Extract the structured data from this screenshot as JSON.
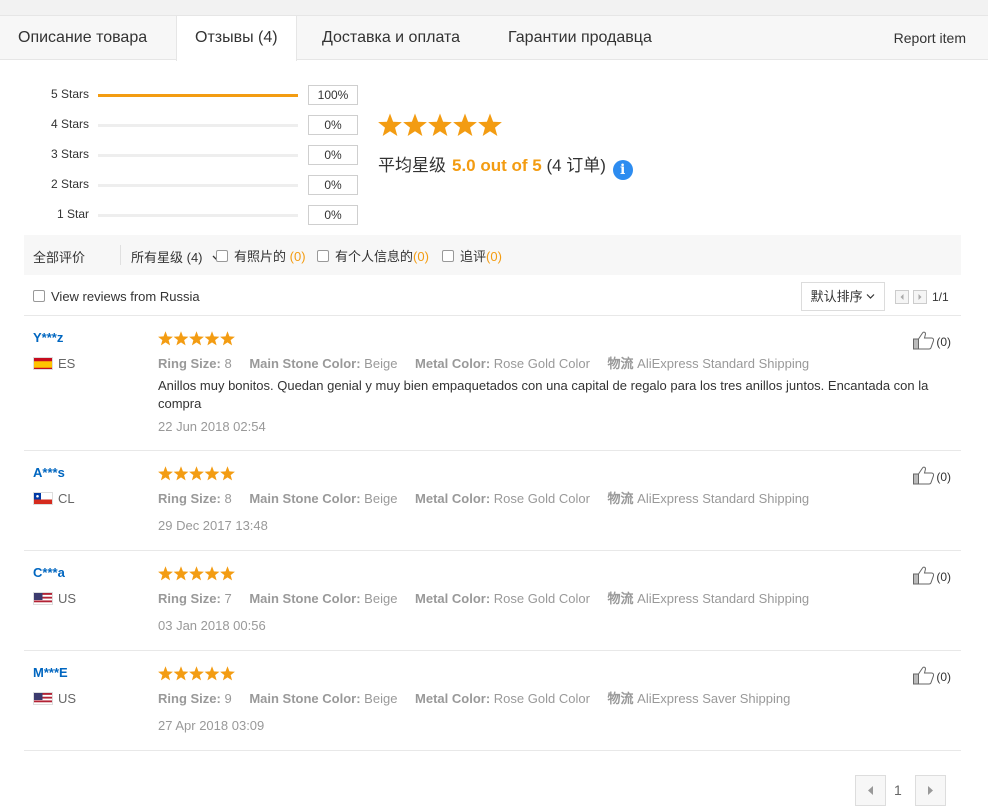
{
  "tabs": [
    {
      "label": "Описание товара"
    },
    {
      "label": "Отзывы (4)"
    },
    {
      "label": "Доставка и оплата"
    },
    {
      "label": "Гарантии продавца"
    }
  ],
  "report_item": "Report item",
  "distribution": [
    {
      "label": "5 Stars",
      "percent_text": "100%",
      "fraction": 1.0
    },
    {
      "label": "4 Stars",
      "percent_text": "0%",
      "fraction": 0
    },
    {
      "label": "3 Stars",
      "percent_text": "0%",
      "fraction": 0
    },
    {
      "label": "2 Stars",
      "percent_text": "0%",
      "fraction": 0
    },
    {
      "label": "1 Star",
      "percent_text": "0%",
      "fraction": 0
    }
  ],
  "summary": {
    "stars": 5,
    "avg_label": "平均星级",
    "avg_value": "5.0 out of 5",
    "orders": "(4 订单)"
  },
  "filters": {
    "all": "全部评价",
    "star_select": "所有星级 (4)",
    "photo": {
      "label": "有照片的",
      "count": "(0)"
    },
    "personal": {
      "label": "有个人信息的",
      "count": "(0)"
    },
    "followup": {
      "label": "追评",
      "count": "(0)"
    }
  },
  "russia_label": "View reviews from Russia",
  "sort_label": "默认排序",
  "page_indicator": "1/1",
  "labels": {
    "ring_size": "Ring Size:",
    "stone_color": "Main Stone Color:",
    "metal_color": "Metal Color:",
    "shipping": "物流"
  },
  "reviews": [
    {
      "user": "Y***z",
      "country": "ES",
      "stars": 5,
      "ring_size": "8",
      "stone_color": "Beige",
      "metal_color": "Rose Gold Color",
      "shipping": "AliExpress Standard Shipping",
      "text": "Anillos muy bonitos. Quedan genial y muy bien empaquetados con una capital de regalo para los tres anillos juntos. Encantada con la compra",
      "date": "22 Jun 2018 02:54",
      "likes": "(0)"
    },
    {
      "user": "A***s",
      "country": "CL",
      "stars": 5,
      "ring_size": "8",
      "stone_color": "Beige",
      "metal_color": "Rose Gold Color",
      "shipping": "AliExpress Standard Shipping",
      "text": "",
      "date": "29 Dec 2017 13:48",
      "likes": "(0)"
    },
    {
      "user": "C***a",
      "country": "US",
      "stars": 5,
      "ring_size": "7",
      "stone_color": "Beige",
      "metal_color": "Rose Gold Color",
      "shipping": "AliExpress Standard Shipping",
      "text": "",
      "date": "03 Jan 2018 00:56",
      "likes": "(0)"
    },
    {
      "user": "M***E",
      "country": "US",
      "stars": 5,
      "ring_size": "9",
      "stone_color": "Beige",
      "metal_color": "Rose Gold Color",
      "shipping": "AliExpress Saver Shipping",
      "text": "",
      "date": "27 Apr 2018 03:09",
      "likes": "(0)"
    }
  ],
  "pager": {
    "current": "1"
  },
  "colors": {
    "accent": "#f39c12",
    "link": "#0066c0",
    "info": "#2d8cf0"
  }
}
